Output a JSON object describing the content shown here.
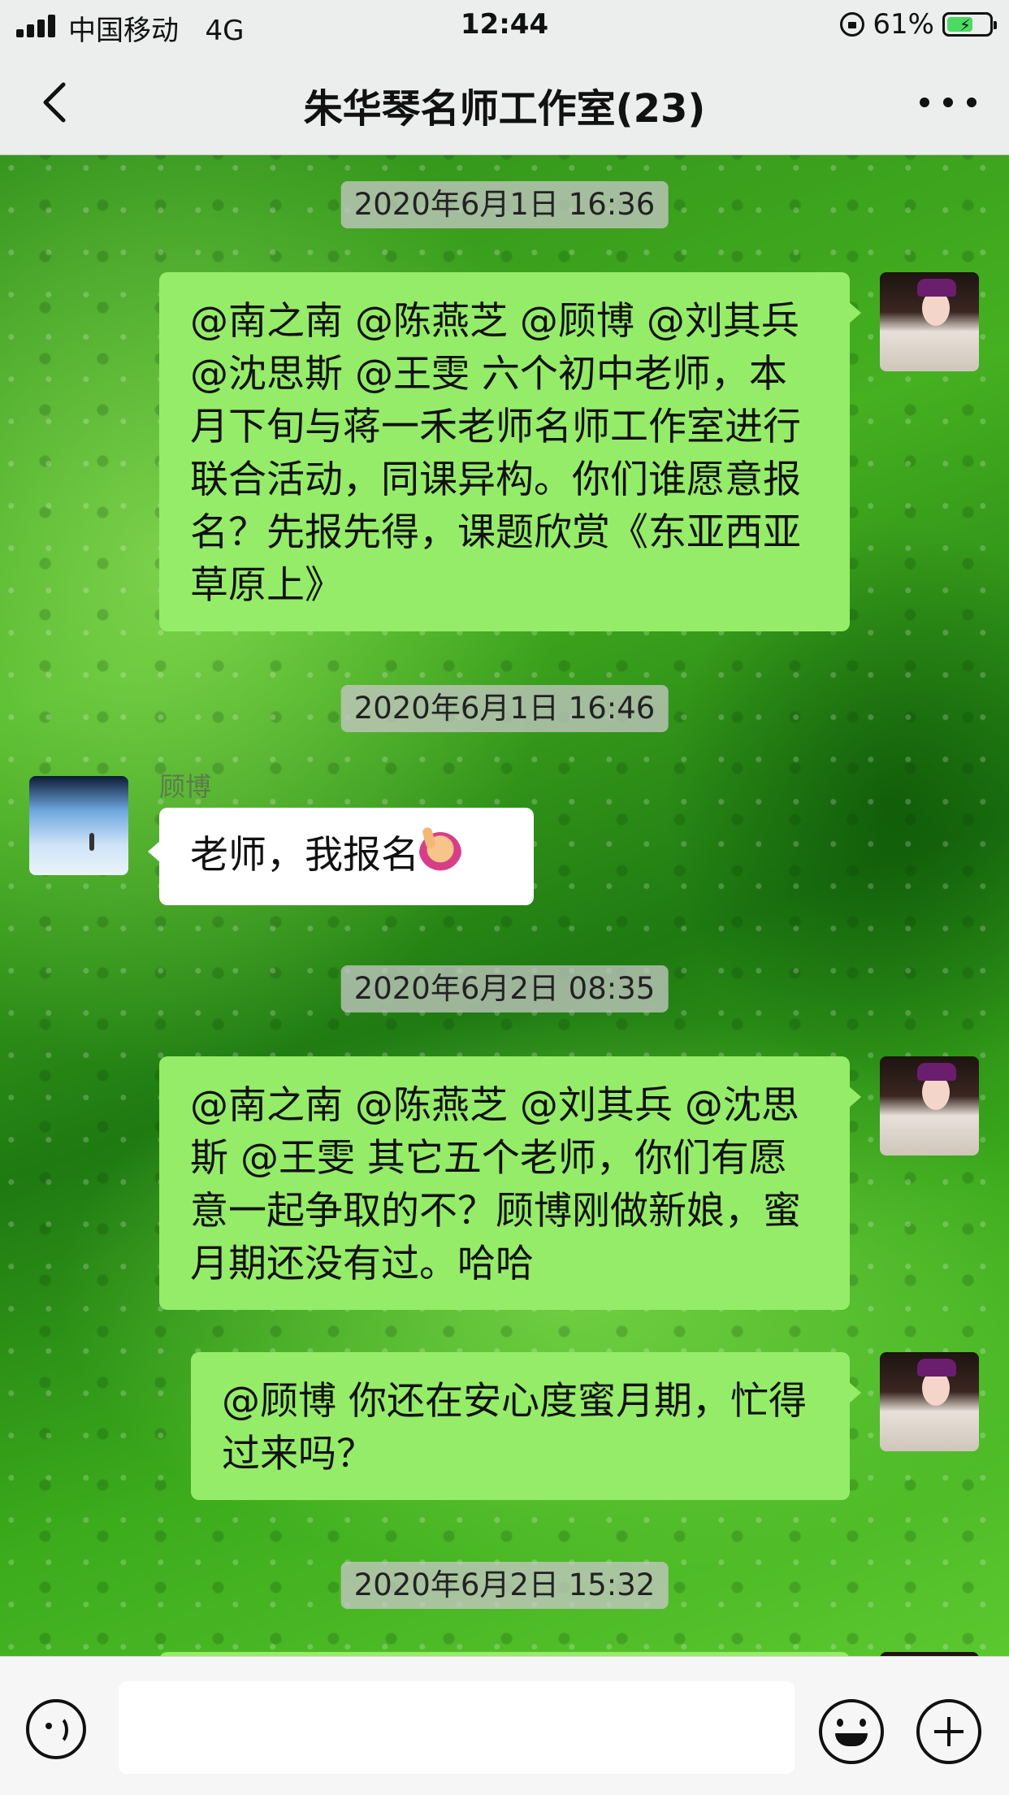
{
  "status_bar": {
    "carrier": "中国移动",
    "network": "4G",
    "time": "12:44",
    "battery_percent": "61%",
    "battery_level": 0.61,
    "charging": true
  },
  "nav": {
    "title": "朱华琴名师工作室(23)",
    "back_icon": "chevron-left-icon",
    "more_icon": "ellipsis-icon"
  },
  "messages": [
    {
      "type": "timestamp",
      "text": "2020年6月1日 16:36"
    },
    {
      "type": "me",
      "text": "@南之南 @陈燕芝 @顾博 @刘其兵 @沈思斯 @王雯 六个初中老师，本月下旬与蒋一禾老师名师工作室进行联合活动，同课异构。你们谁愿意报名？先报先得，课题欣赏《东亚西亚草原上》"
    },
    {
      "type": "timestamp",
      "text": "2020年6月1日 16:46"
    },
    {
      "type": "other",
      "sender": "顾博",
      "text": "老师，我报名"
    },
    {
      "type": "timestamp",
      "text": "2020年6月2日 08:35"
    },
    {
      "type": "me",
      "text": "@南之南 @陈燕芝 @刘其兵 @沈思斯 @王雯 其它五个老师，你们有愿意一起争取的不？顾博刚做新娘，蜜月期还没有过。哈哈"
    },
    {
      "type": "me",
      "text": "@顾博 你还在安心度蜜月期，忙得过来吗？"
    },
    {
      "type": "timestamp",
      "text": "2020年6月2日 15:32"
    }
  ],
  "input_bar": {
    "voice_icon": "voice-icon",
    "input_value": "",
    "emoji_icon": "emoji-icon",
    "plus_icon": "plus-icon"
  },
  "colors": {
    "my_bubble": "#95ec69",
    "other_bubble": "#ffffff",
    "bar_bg": "#eceeed"
  }
}
